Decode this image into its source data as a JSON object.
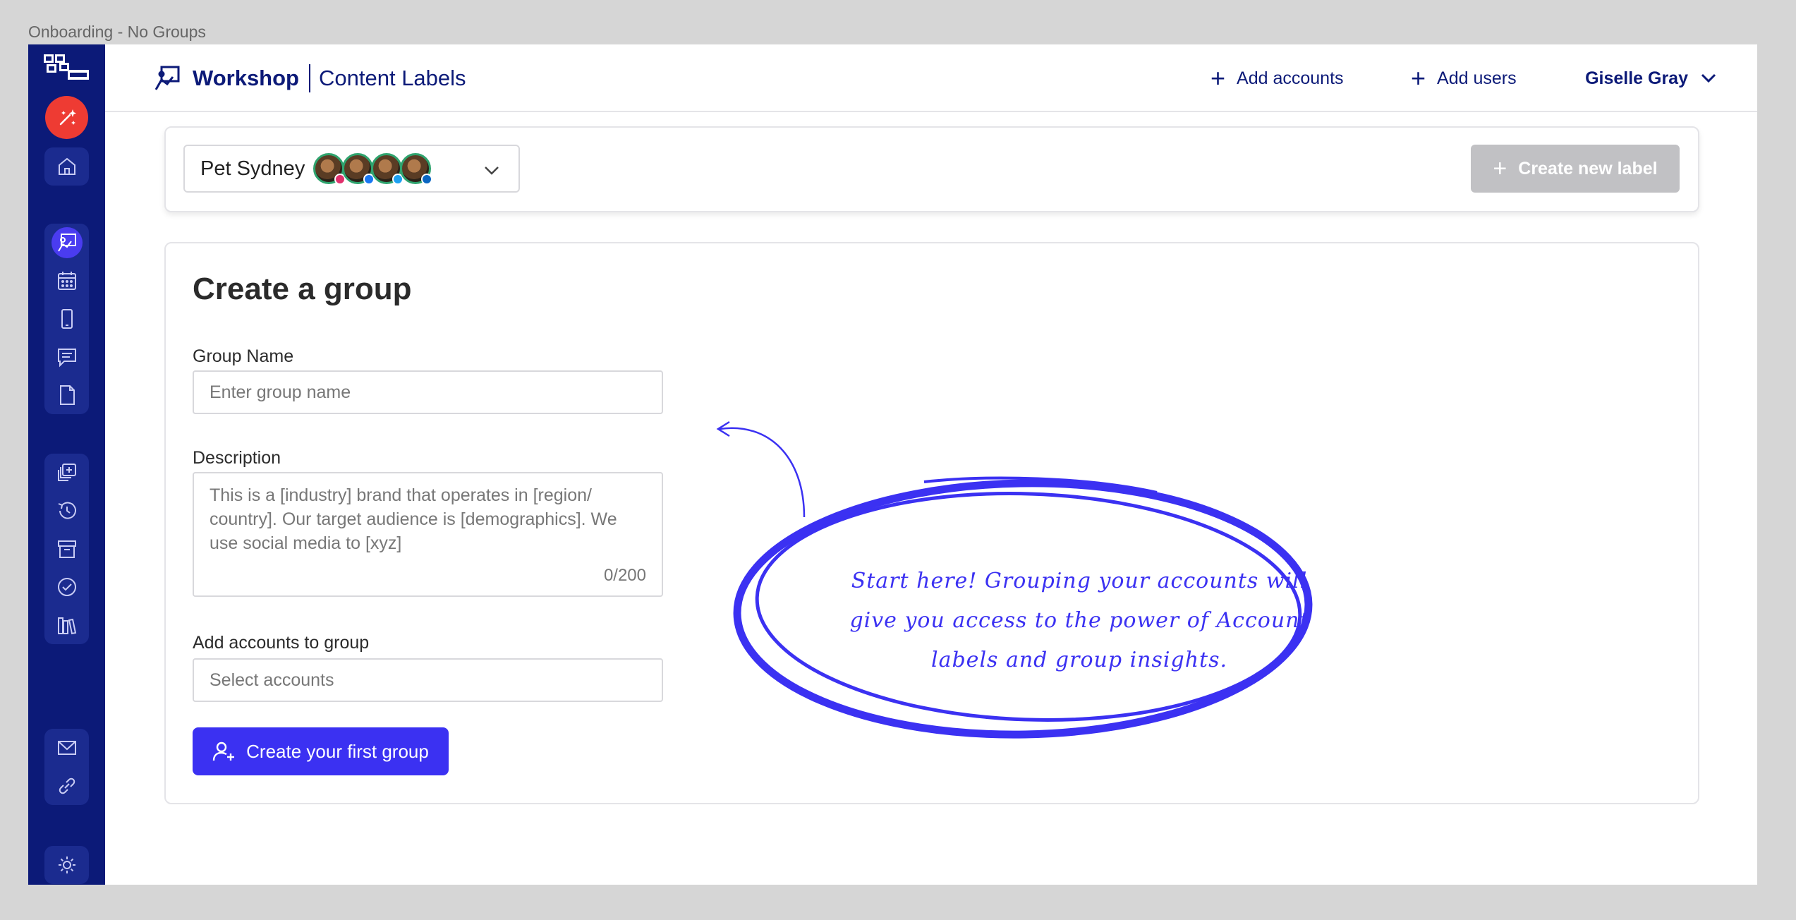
{
  "frame": {
    "title": "Onboarding - No Groups"
  },
  "sidebar": {
    "logo": "social-logo",
    "items": [
      {
        "name": "home",
        "icon": "home-icon"
      },
      {
        "name": "workshop",
        "icon": "workshop-icon",
        "active": true
      },
      {
        "name": "calendar",
        "icon": "calendar-icon"
      },
      {
        "name": "mobile",
        "icon": "mobile-icon"
      },
      {
        "name": "messages",
        "icon": "chat-icon"
      },
      {
        "name": "document",
        "icon": "document-icon"
      },
      {
        "name": "library-add",
        "icon": "layers-add-icon"
      },
      {
        "name": "history",
        "icon": "history-icon"
      },
      {
        "name": "archive",
        "icon": "archive-icon"
      },
      {
        "name": "approvals",
        "icon": "check-circle-icon"
      },
      {
        "name": "library",
        "icon": "books-icon"
      },
      {
        "name": "mail",
        "icon": "mail-icon"
      },
      {
        "name": "links",
        "icon": "link-icon"
      },
      {
        "name": "settings",
        "icon": "cog-icon"
      }
    ]
  },
  "header": {
    "brand_name": "Workshop",
    "brand_sub": "Content Labels",
    "add_accounts": "Add accounts",
    "add_users": "Add users",
    "user_name": "Giselle Gray"
  },
  "toolbar": {
    "account_name": "Pet Sydney",
    "avatars": [
      {
        "network": "instagram",
        "color": "#e1306c"
      },
      {
        "network": "facebook",
        "color": "#1877f2"
      },
      {
        "network": "twitter",
        "color": "#1da1f2"
      },
      {
        "network": "linkedin",
        "color": "#0a66c2"
      }
    ],
    "create_label": "Create new label"
  },
  "form": {
    "title": "Create a group",
    "group_name_label": "Group Name",
    "group_name_placeholder": "Enter group name",
    "description_label": "Description",
    "description_placeholder": "This is a [industry] brand that operates in [region/ country]. Our target audience is [demographics]. We use social media to [xyz]",
    "description_counter": "0/200",
    "accounts_label": "Add accounts to group",
    "accounts_placeholder": "Select accounts",
    "submit": "Create your first group"
  },
  "annotation": {
    "text": "Start here! Grouping your accounts will give you access to the power of Account labels and group insights.",
    "color": "#3b31f2"
  },
  "colors": {
    "sidebar": "#0c1a78",
    "accent": "#3b31f2",
    "alert": "#ee3b33",
    "disabled": "#c1c1c4"
  }
}
